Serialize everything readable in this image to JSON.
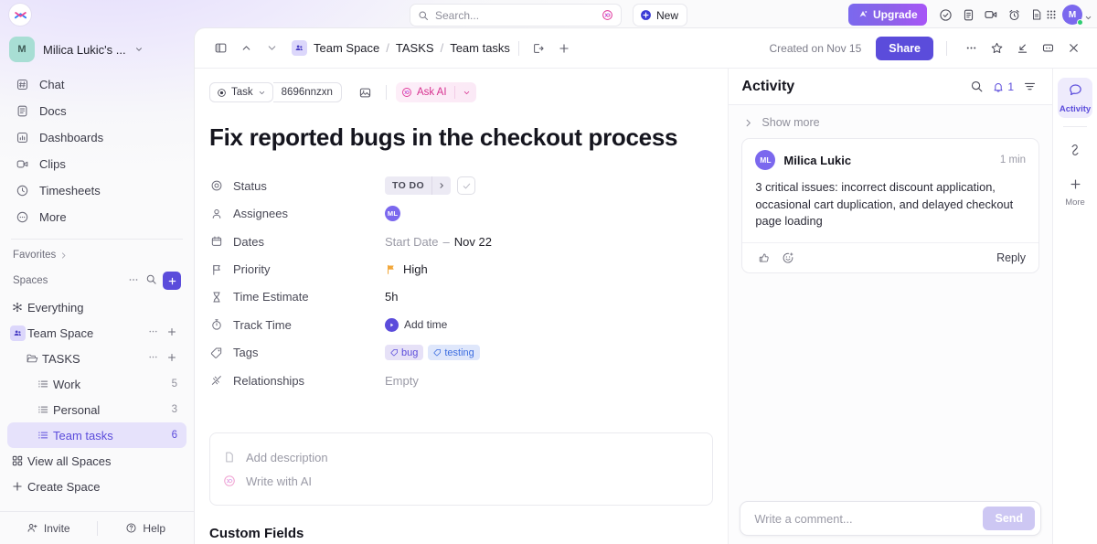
{
  "topbar": {
    "logo": "clickup-logo",
    "search": {
      "placeholder": "Search...",
      "ai_icon": "ai-sparkle-icon"
    },
    "new_button": {
      "label": "New",
      "icon": "plus-circle-icon"
    },
    "upgrade_button": {
      "label": "Upgrade",
      "icon": "rocket-icon"
    },
    "icons": [
      {
        "name": "check-circle-icon"
      },
      {
        "name": "clipboard-icon"
      },
      {
        "name": "video-camera-icon"
      },
      {
        "name": "alarm-clock-icon"
      },
      {
        "name": "document-icon"
      },
      {
        "name": "apps-grid-icon"
      }
    ],
    "avatar": {
      "initial": "M",
      "status": "online"
    }
  },
  "sidebar": {
    "workspace": {
      "initial": "M",
      "name": "Milica Lukic's ...",
      "caret": "chevron-down-icon"
    },
    "nav": [
      {
        "label": "Chat",
        "icon": "chat-hash-icon"
      },
      {
        "label": "Docs",
        "icon": "docs-icon"
      },
      {
        "label": "Dashboards",
        "icon": "dashboards-bar-icon"
      },
      {
        "label": "Clips",
        "icon": "clips-video-icon"
      },
      {
        "label": "Timesheets",
        "icon": "timesheets-clock-icon"
      },
      {
        "label": "More",
        "icon": "more-dots-icon"
      }
    ],
    "favorites": {
      "label": "Favorites",
      "chevron": "chevron-right-icon"
    },
    "spaces": {
      "label": "Spaces",
      "ellipsis_icon": "ellipsis-icon",
      "search_icon": "search-icon",
      "add_icon": "plus-icon"
    },
    "tree": [
      {
        "label": "Everything",
        "icon": "everything-icon",
        "indent": 0,
        "count": "",
        "active": false
      },
      {
        "label": "Team Space",
        "icon": "team-space-icon",
        "indent": 0,
        "count": "",
        "active": false,
        "actions": true
      },
      {
        "label": "TASKS",
        "icon": "folder-icon",
        "indent": 1,
        "count": "",
        "active": false,
        "actions": true
      },
      {
        "label": "Work",
        "icon": "list-icon",
        "indent": 2,
        "count": "5",
        "active": false
      },
      {
        "label": "Personal",
        "icon": "list-icon",
        "indent": 2,
        "count": "3",
        "active": false
      },
      {
        "label": "Team tasks",
        "icon": "list-icon",
        "indent": 2,
        "count": "6",
        "active": true
      }
    ],
    "view_all_spaces": {
      "label": "View all Spaces",
      "icon": "grid-squares-icon"
    },
    "create_space": {
      "label": "Create Space",
      "icon": "plus-icon"
    },
    "footer": {
      "invite": {
        "label": "Invite",
        "icon": "user-plus-icon"
      },
      "help": {
        "label": "Help",
        "icon": "help-circle-icon"
      }
    }
  },
  "task_header": {
    "sidebar_toggle_icon": "panel-toggle-icon",
    "prev_icon": "chevron-up-icon",
    "next_icon": "chevron-down-icon",
    "breadcrumb": [
      {
        "label": "Team Space",
        "icon": "team-space-icon"
      },
      {
        "label": "TASKS"
      },
      {
        "label": "Team tasks"
      }
    ],
    "open_icon": "open-external-icon",
    "add_icon": "plus-icon",
    "created_on": "Created on Nov 15",
    "share_label": "Share",
    "actions": [
      {
        "name": "more-ellipsis-icon"
      },
      {
        "name": "star-icon"
      },
      {
        "name": "collapse-arrow-icon"
      },
      {
        "name": "minimize-icon"
      },
      {
        "name": "close-icon"
      }
    ]
  },
  "task": {
    "type_label": "Task",
    "type_icon": "task-target-icon",
    "id": "8696nnzxn",
    "image_icon": "image-icon",
    "ask_ai_label": "Ask AI",
    "ask_ai_icon": "ai-sparkle-icon",
    "title": "Fix reported bugs in the checkout process",
    "fields": [
      {
        "label": "Status",
        "icon": "status-circle-icon",
        "type": "status",
        "value": "TO DO"
      },
      {
        "label": "Assignees",
        "icon": "assignee-person-icon",
        "type": "avatar",
        "value": "ML"
      },
      {
        "label": "Dates",
        "icon": "calendar-icon",
        "type": "dates",
        "value_muted": "Start Date",
        "dash": "–",
        "value": "Nov 22"
      },
      {
        "label": "Priority",
        "icon": "flag-icon",
        "type": "priority",
        "value": "High"
      },
      {
        "label": "Time Estimate",
        "icon": "hourglass-icon",
        "type": "text",
        "value": "5h"
      },
      {
        "label": "Track Time",
        "icon": "stopwatch-icon",
        "type": "track",
        "value": "Add time"
      },
      {
        "label": "Tags",
        "icon": "tag-icon",
        "type": "tags",
        "tags": [
          {
            "label": "bug",
            "color": "purple"
          },
          {
            "label": "testing",
            "color": "blue"
          }
        ]
      },
      {
        "label": "Relationships",
        "icon": "relationships-icon",
        "type": "empty",
        "value": "Empty"
      }
    ],
    "description": {
      "add_label": "Add description",
      "add_icon": "page-icon",
      "ai_label": "Write with AI",
      "ai_icon": "ai-sparkle-icon"
    },
    "custom_fields_title": "Custom Fields"
  },
  "activity": {
    "title": "Activity",
    "search_icon": "search-icon",
    "bell_icon": "bell-icon",
    "bell_count": "1",
    "filter_icon": "filter-icon",
    "show_more": "Show more",
    "show_more_icon": "chevron-right-icon",
    "comments": [
      {
        "avatar": "ML",
        "author": "Milica Lukic",
        "time": "1 min",
        "text": "3 critical issues: incorrect discount application, occasional cart duplication, and delayed checkout page loading",
        "like_icon": "thumbs-up-icon",
        "emoji_icon": "add-reaction-icon",
        "reply_label": "Reply"
      }
    ],
    "composer": {
      "placeholder": "Write a comment...",
      "send_label": "Send"
    }
  },
  "rail": {
    "tabs": [
      {
        "label": "Activity",
        "icon": "activity-comment-icon",
        "active": true
      }
    ],
    "link_icon": "link-chain-icon",
    "more": {
      "label": "More",
      "icon": "plus-icon"
    }
  },
  "colors": {
    "accent": "#5b4cdb",
    "upgrade_gradient_start": "#7b68ee",
    "upgrade_gradient_end": "#a855f7",
    "ai_pink": "#d6318f",
    "priority_flag": "#f2a73b",
    "tag_purple": "#5b4cdb",
    "tag_blue": "#3c6de0",
    "online_green": "#2ecc71",
    "workspace_avatar": "#a8ded4"
  }
}
